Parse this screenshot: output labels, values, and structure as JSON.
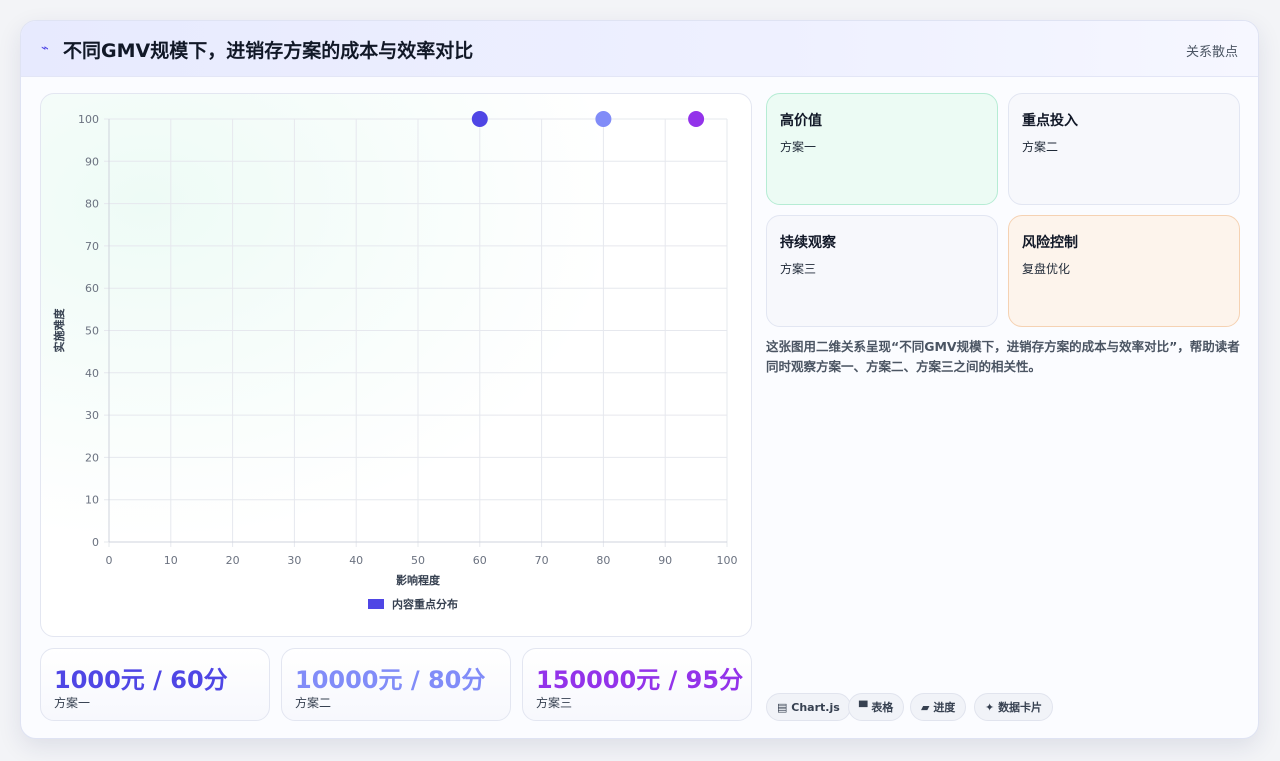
{
  "header": {
    "icon": "bolt-icon",
    "title": "不同GMV规模下，进销存方案的成本与效率对比",
    "tag": "关系散点"
  },
  "chart_data": {
    "type": "scatter",
    "xlabel": "影响程度",
    "ylabel": "实施难度",
    "xlim": [
      0,
      100
    ],
    "ylim": [
      0,
      100
    ],
    "x_ticks": [
      "0",
      "10",
      "20",
      "30",
      "40",
      "50",
      "60",
      "70",
      "80",
      "90",
      "100"
    ],
    "y_ticks": [
      "0",
      "10",
      "20",
      "30",
      "40",
      "50",
      "60",
      "70",
      "80",
      "90",
      "100"
    ],
    "grid": true,
    "legend": {
      "position": "bottom",
      "label": "内容重点分布",
      "color": "#4f46e5"
    },
    "points": [
      {
        "label": "方案一",
        "x": 60,
        "y": 100,
        "color": "#4f46e5"
      },
      {
        "label": "方案二",
        "x": 80,
        "y": 100,
        "color": "#818cf8"
      },
      {
        "label": "方案三",
        "x": 95,
        "y": 100,
        "color": "#9333ea"
      }
    ]
  },
  "kpis": [
    {
      "value": "1000元 / 60分",
      "label": "方案一",
      "color": "#4f46e5"
    },
    {
      "value": "10000元 / 80分",
      "label": "方案二",
      "color": "#818cf8"
    },
    {
      "value": "150000元 / 95分",
      "label": "方案三",
      "color": "#9333ea"
    }
  ],
  "quadrants": [
    {
      "title": "高价值",
      "sub": "方案一"
    },
    {
      "title": "重点投入",
      "sub": "方案二"
    },
    {
      "title": "持续观察",
      "sub": "方案三"
    },
    {
      "title": "风险控制",
      "sub": "复盘优化"
    }
  ],
  "description": "这张图用二维关系呈现“不同GMV规模下，进销存方案的成本与效率对比”，帮助读者同时观察方案一、方案二、方案三之间的相关性。",
  "pills": [
    {
      "icon": "chart-icon",
      "glyph": "▤",
      "label": "Chart.js"
    },
    {
      "icon": "table-icon",
      "glyph": "▀",
      "label": "表格"
    },
    {
      "icon": "progress-icon",
      "glyph": "▰",
      "label": "进度"
    },
    {
      "icon": "card-icon",
      "glyph": "✦",
      "label": "数据卡片"
    }
  ]
}
